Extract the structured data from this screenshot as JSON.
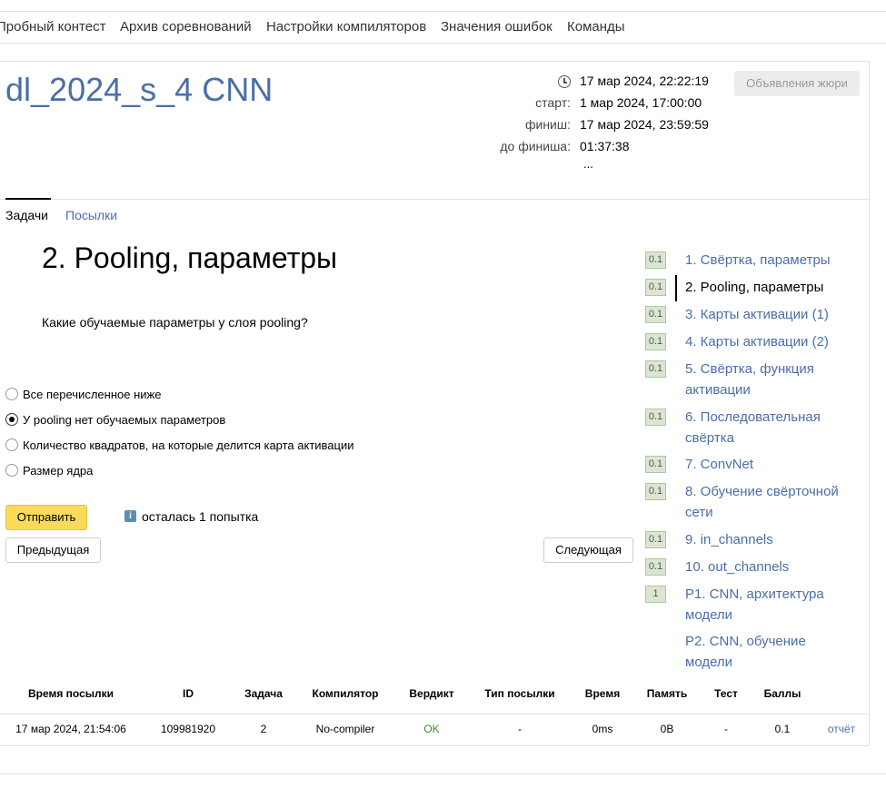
{
  "nav": {
    "items": [
      "Пробный контест",
      "Архив соревнований",
      "Настройки компиляторов",
      "Значения ошибок",
      "Команды"
    ]
  },
  "contest": {
    "title": "dl_2024_s_4 CNN",
    "now": "17 мар 2024, 22:22:19",
    "start_label": "старт:",
    "start": "1 мар 2024, 17:00:00",
    "finish_label": "финиш:",
    "finish": "17 мар 2024, 23:59:59",
    "remaining_label": "до финиша:",
    "remaining": "01:37:38",
    "more": "...",
    "jury_button": "Объявления жюри"
  },
  "tabs": {
    "tasks": "Задачи",
    "submissions": "Посылки"
  },
  "problem": {
    "title": "2. Pooling, параметры",
    "question": "Какие обучаемые параметры у слоя pooling?",
    "options": [
      "Все перечисленное ниже",
      "У pooling нет обучаемых параметров",
      "Количество квадратов, на которые делится карта активации",
      "Размер ядра"
    ],
    "selected_option": 1,
    "submit": "Отправить",
    "attempts": "осталась 1 попытка",
    "info_icon": "i",
    "prev": "Предыдущая",
    "next": "Следующая"
  },
  "problem_list": [
    {
      "score": "0.1",
      "label": "1. Свёртка, параметры"
    },
    {
      "score": "0.1",
      "label": "2. Pooling, параметры"
    },
    {
      "score": "0.1",
      "label": "3. Карты активации (1)"
    },
    {
      "score": "0.1",
      "label": "4. Карты активации (2)"
    },
    {
      "score": "0.1",
      "label": "5. Свёртка, функция активации"
    },
    {
      "score": "0.1",
      "label": "6. Последовательная свёртка"
    },
    {
      "score": "0.1",
      "label": "7. ConvNet"
    },
    {
      "score": "0.1",
      "label": "8. Обучение свёрточной сети"
    },
    {
      "score": "0.1",
      "label": "9. in_channels"
    },
    {
      "score": "0.1",
      "label": "10. out_channels"
    },
    {
      "score": "1",
      "label": "P1. CNN, архитектура модели"
    },
    {
      "score": "",
      "label": "P2. CNN, обучение модели"
    }
  ],
  "submissions": {
    "headers": [
      "Время посылки",
      "ID",
      "Задача",
      "Компилятор",
      "Вердикт",
      "Тип посылки",
      "Время",
      "Память",
      "Тест",
      "Баллы"
    ],
    "rows": [
      [
        "17 мар 2024, 21:54:06",
        "109981920",
        "2",
        "No-compiler",
        "OK",
        "-",
        "0ms",
        "0B",
        "-",
        "0.1",
        "отчёт"
      ]
    ]
  },
  "colors": {
    "accent": "#4a6ea9",
    "submit": "#f9db59",
    "ok": "#3c8a2e"
  },
  "icons": {
    "clock": "clock-icon",
    "info": "info-icon"
  }
}
